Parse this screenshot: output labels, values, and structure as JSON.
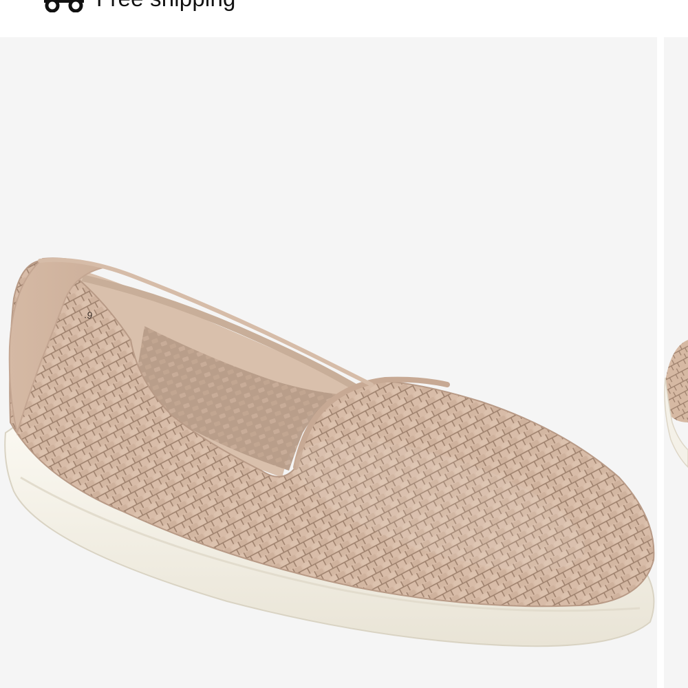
{
  "shipping": {
    "label": "Free shipping",
    "icon": "truck-icon"
  },
  "gallery": {
    "main_image_alt": "Woven leather slip-on loafer in tan with white rubber sole",
    "next_image_alt": "Next product image preview"
  },
  "colors": {
    "background": "#ffffff",
    "image_bg": "#f5f5f5",
    "leather": "#d8bca8",
    "leather_shadow": "#a78a76",
    "sole": "#f4f1e8",
    "lining": "#d9c0ac"
  }
}
